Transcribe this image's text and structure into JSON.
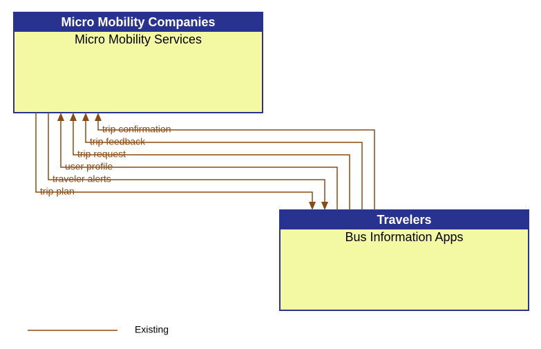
{
  "block_a": {
    "header": "Micro Mobility Companies",
    "title": "Micro Mobility Services"
  },
  "block_b": {
    "header": "Travelers",
    "title": "Bus Information Apps"
  },
  "flows": {
    "f1": "trip confirmation",
    "f2": "trip feedback",
    "f3": "trip request",
    "f4": "user profile",
    "f5": "traveler alerts",
    "f6": "trip plan"
  },
  "legend": {
    "existing": "Existing"
  },
  "colors": {
    "header_bg": "#27338f",
    "body_bg": "#f2f9a2",
    "flow": "#8b4a12"
  },
  "chart_data": {
    "type": "flow-diagram",
    "nodes": [
      {
        "id": "micro",
        "group": "Micro Mobility Companies",
        "label": "Micro Mobility Services"
      },
      {
        "id": "bus",
        "group": "Travelers",
        "label": "Bus Information Apps"
      }
    ],
    "edges": [
      {
        "from": "bus",
        "to": "micro",
        "label": "trip confirmation",
        "status": "Existing"
      },
      {
        "from": "bus",
        "to": "micro",
        "label": "trip feedback",
        "status": "Existing"
      },
      {
        "from": "bus",
        "to": "micro",
        "label": "trip request",
        "status": "Existing"
      },
      {
        "from": "bus",
        "to": "micro",
        "label": "user profile",
        "status": "Existing"
      },
      {
        "from": "micro",
        "to": "bus",
        "label": "traveler alerts",
        "status": "Existing"
      },
      {
        "from": "micro",
        "to": "bus",
        "label": "trip plan",
        "status": "Existing"
      }
    ],
    "legend": [
      {
        "style": "solid",
        "label": "Existing"
      }
    ]
  }
}
